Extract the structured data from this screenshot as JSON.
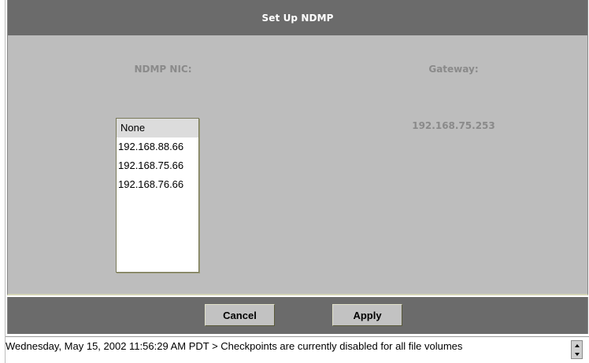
{
  "window": {
    "title": "Set Up NDMP"
  },
  "form": {
    "nic_label": "NDMP NIC:",
    "gateway_label": "Gateway:",
    "gateway_value": "192.168.75.253",
    "nic_options": [
      "None",
      "192.168.88.66",
      "192.168.75.66",
      "192.168.76.66"
    ],
    "nic_selected": "None"
  },
  "buttons": {
    "cancel_label": "Cancel",
    "apply_label": "Apply"
  },
  "status": {
    "message": "Wednesday, May 15, 2002 11:56:29 AM PDT > Checkpoints are currently disabled for all file volumes"
  },
  "colors": {
    "title_bar": "#6b6b6b",
    "panel": "#bdbdbd",
    "label_text": "#8a8a8a"
  }
}
